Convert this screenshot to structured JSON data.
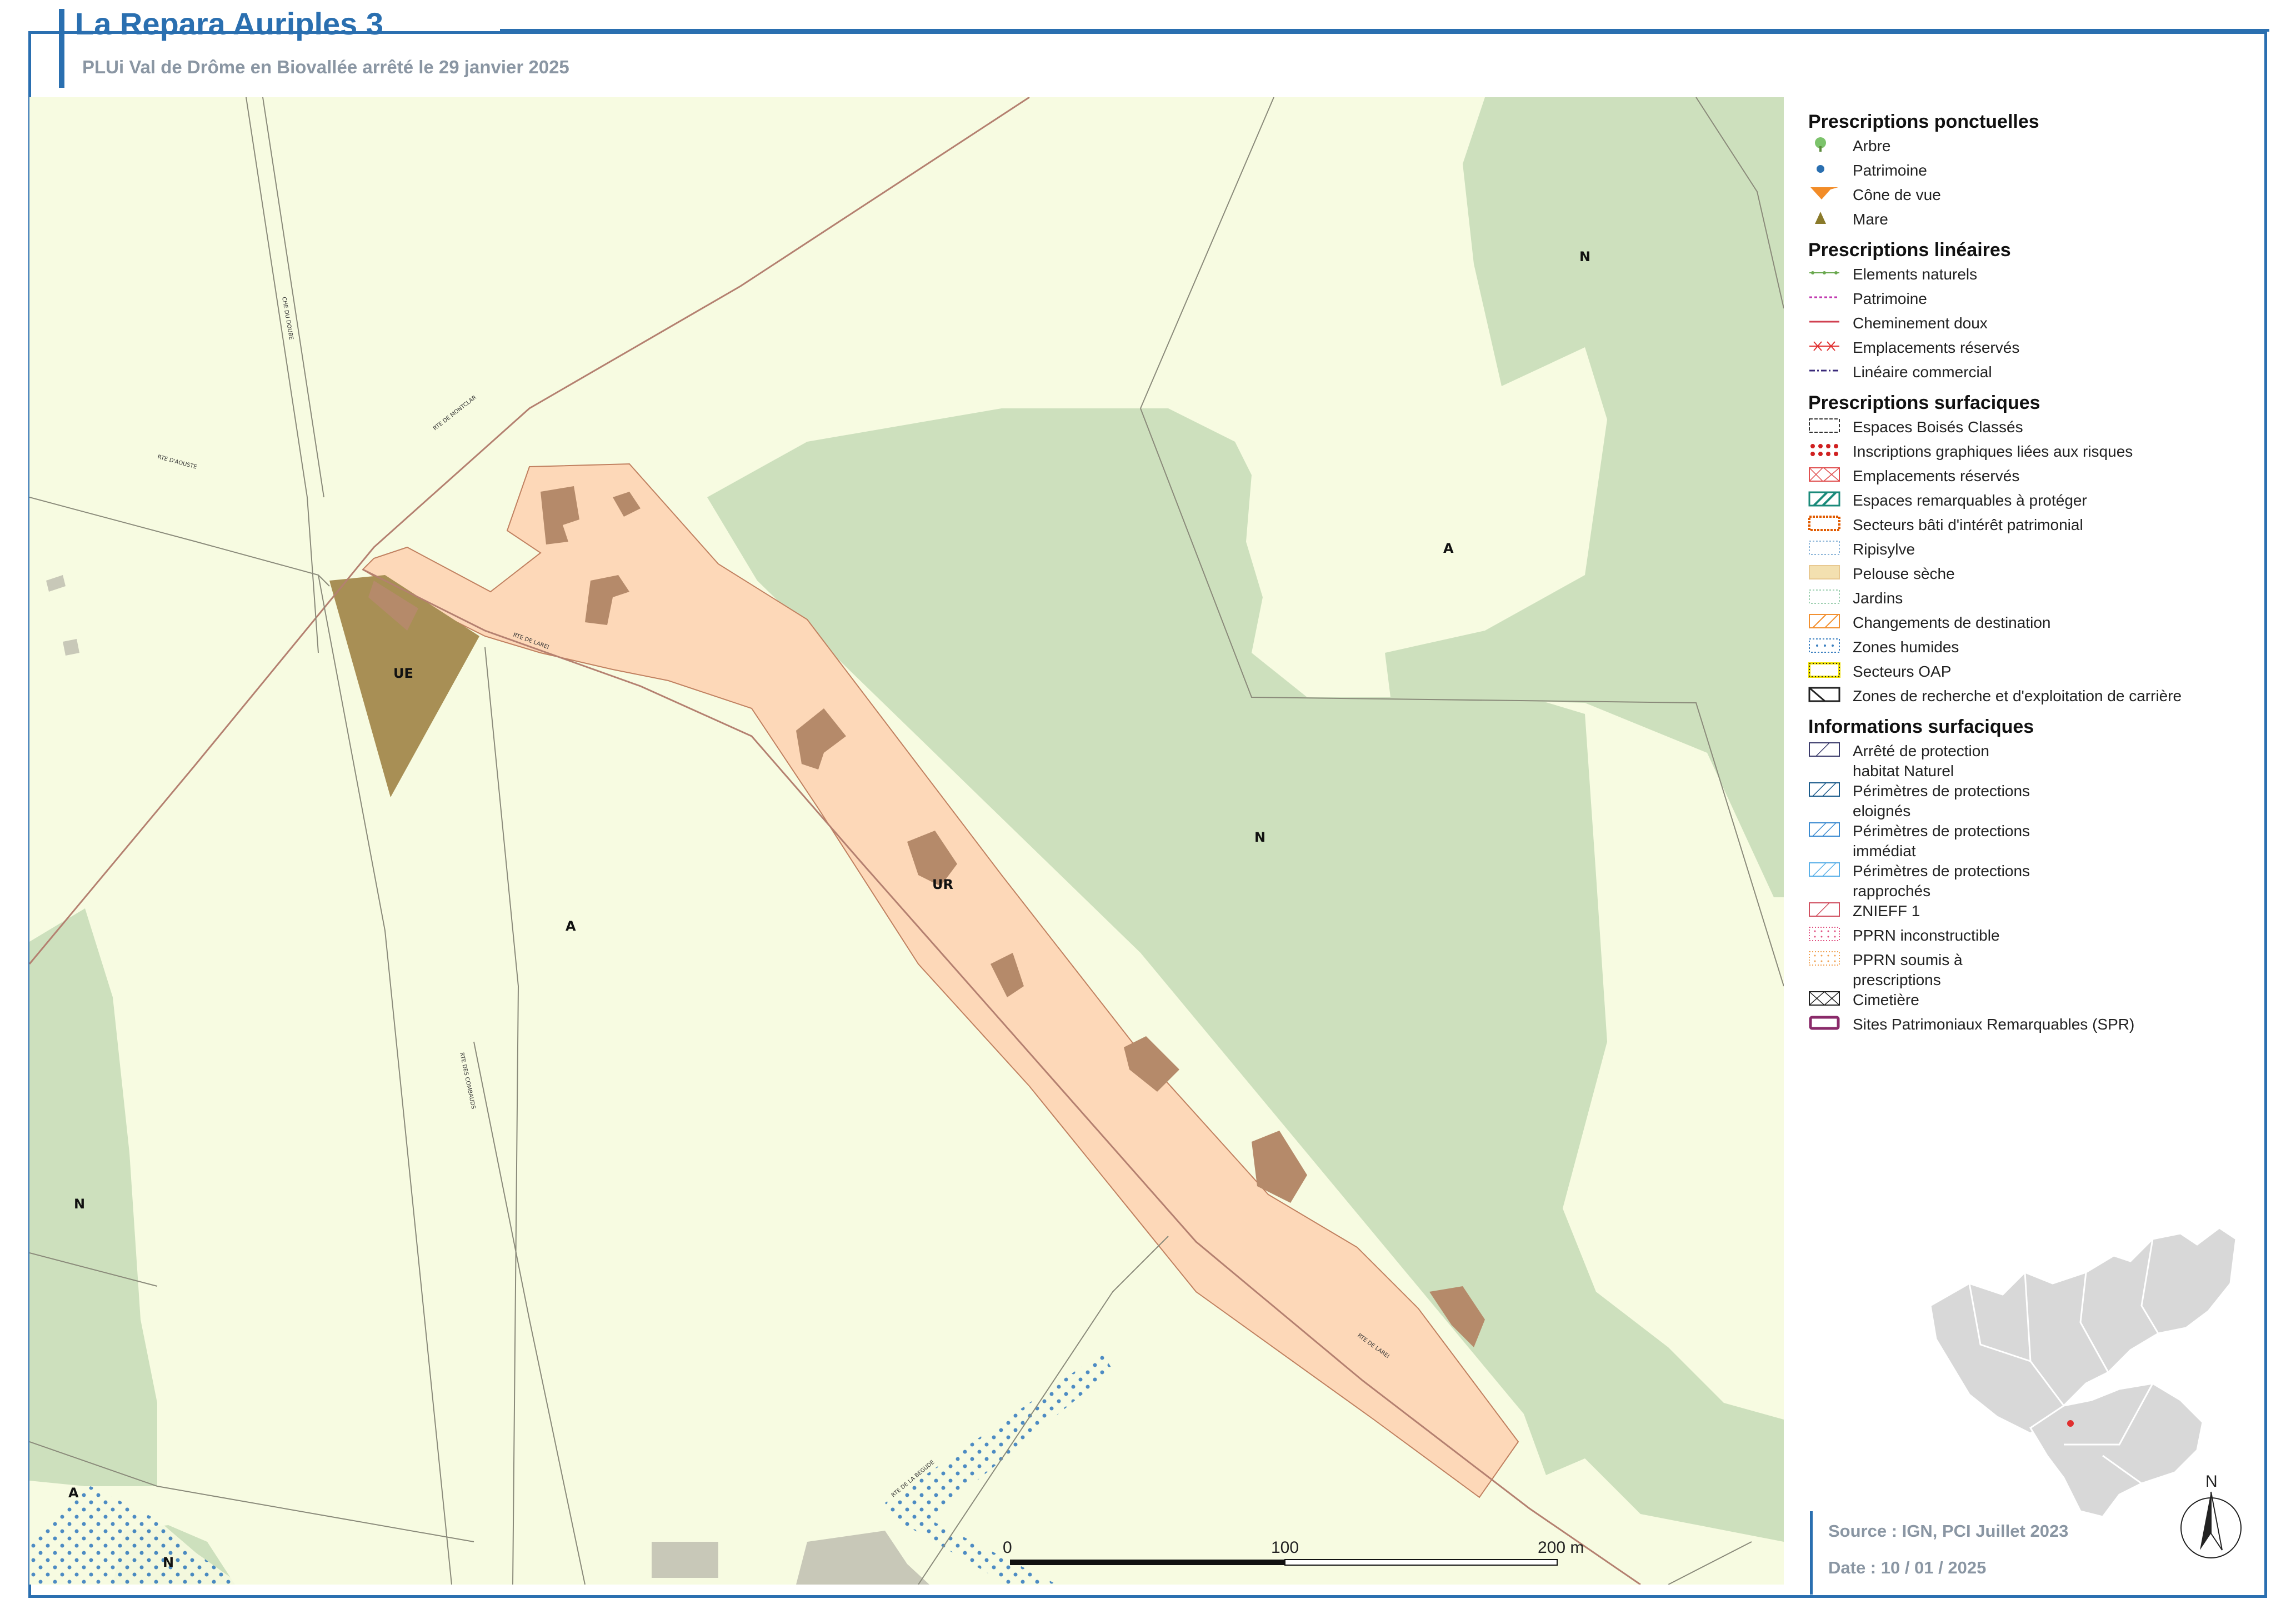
{
  "header": {
    "title": "La Repara Auriples 3",
    "subtitle": "PLUi Val de Drôme en Biovallée arrêté le 29 janvier 2025"
  },
  "colors": {
    "accent": "#2a6fb0",
    "zone_A": "#f7fbe1",
    "zone_N": "#cde0bd",
    "zone_UR": "#fdd8b8",
    "zone_UE": "#a88f55",
    "buildings": "#b58a6a"
  },
  "map": {
    "zone_labels": [
      {
        "id": "N-top",
        "text": "N"
      },
      {
        "id": "A-top",
        "text": "A"
      },
      {
        "id": "N-center",
        "text": "N"
      },
      {
        "id": "UR",
        "text": "UR"
      },
      {
        "id": "UE",
        "text": "UE"
      },
      {
        "id": "A-main",
        "text": "A"
      },
      {
        "id": "N-left",
        "text": "N"
      },
      {
        "id": "A-bottom",
        "text": "A"
      },
      {
        "id": "N-bottom",
        "text": "N"
      }
    ],
    "road_labels": [
      "CHE DU DOUBE",
      "RTE DE MONTCLAR",
      "RTE D'AOUSTE",
      "RTE DE LAREI",
      "RTE DES COMBAUDS",
      "RTE DE LAREI",
      "RTE DE LA BEGUDE"
    ],
    "scale": {
      "label_0": "0",
      "label_100": "100",
      "label_200": "200 m"
    }
  },
  "legend": {
    "sections": [
      {
        "title": "Prescriptions ponctuelles",
        "items": [
          {
            "label": "Arbre",
            "icon": "tree-icon"
          },
          {
            "label": "Patrimoine",
            "icon": "dot-icon"
          },
          {
            "label": "Cône de vue",
            "icon": "view-cone-icon"
          },
          {
            "label": "Mare",
            "icon": "triangle-icon"
          }
        ]
      },
      {
        "title": "Prescriptions linéaires",
        "items": [
          {
            "label": "Elements naturels",
            "icon": "line-green-dots"
          },
          {
            "label": "Patrimoine",
            "icon": "line-magenta-dash"
          },
          {
            "label": "Cheminement doux",
            "icon": "line-red"
          },
          {
            "label": "Emplacements réservés",
            "icon": "line-red-cross"
          },
          {
            "label": "Linéaire commercial",
            "icon": "line-purple-dash"
          }
        ]
      },
      {
        "title": "Prescriptions surfaciques",
        "items": [
          {
            "label": "Espaces Boisés Classés",
            "icon": "ebc-swatch"
          },
          {
            "label": "Inscriptions graphiques liées aux risques",
            "icon": "risk-swatch"
          },
          {
            "label": "Emplacements réservés",
            "icon": "er-swatch"
          },
          {
            "label": "Espaces remarquables à protéger",
            "icon": "remarkable-swatch"
          },
          {
            "label": "Secteurs bâti d'intérêt patrimonial",
            "icon": "heritage-swatch"
          },
          {
            "label": "Ripisylve",
            "icon": "ripisylve-swatch"
          },
          {
            "label": "Pelouse sèche",
            "icon": "pelouse-swatch"
          },
          {
            "label": "Jardins",
            "icon": "jardins-swatch"
          },
          {
            "label": "Changements de destination",
            "icon": "destination-swatch"
          },
          {
            "label": "Zones humides",
            "icon": "wetland-swatch"
          },
          {
            "label": "Secteurs OAP",
            "icon": "oap-swatch"
          },
          {
            "label": "Zones de recherche et d'exploitation de carrière",
            "icon": "quarry-swatch"
          }
        ]
      },
      {
        "title": "Informations surfaciques",
        "items": [
          {
            "label": "Arrêté de protection habitat Naturel",
            "icon": "aphn-swatch",
            "two_lines": true
          },
          {
            "label": "Périmètres de protections eloignés",
            "icon": "ppe-swatch",
            "two_lines": true
          },
          {
            "label": "Périmètres de protections immédiat",
            "icon": "ppi-swatch",
            "two_lines": true
          },
          {
            "label": "Périmètres de protections rapprochés",
            "icon": "ppr-swatch",
            "two_lines": true
          },
          {
            "label": "ZNIEFF 1",
            "icon": "znieff-swatch"
          },
          {
            "label": "PPRN inconstructible",
            "icon": "pprn-i-swatch"
          },
          {
            "label": "PPRN soumis à prescriptions",
            "icon": "pprn-s-swatch",
            "two_lines": true
          },
          {
            "label": "Cimetière",
            "icon": "cemetery-swatch"
          },
          {
            "label": "Sites Patrimoniaux Remarquables (SPR)",
            "icon": "spr-swatch"
          }
        ]
      }
    ]
  },
  "footer": {
    "source": "Source : IGN, PCI Juillet 2023",
    "date": "Date : 10 / 01 / 2025"
  },
  "north_arrow": {
    "label": "N"
  }
}
